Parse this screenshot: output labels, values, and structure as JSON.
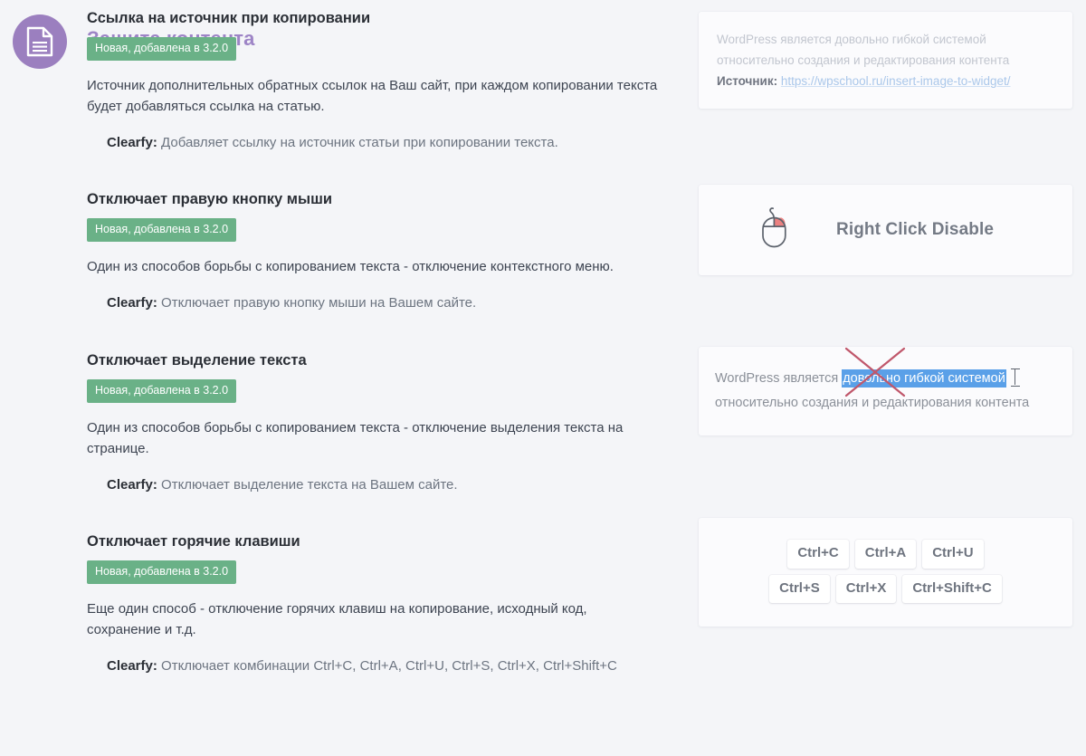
{
  "header": {
    "icon": "document-icon",
    "title": "Защита контента",
    "icon_circle_color": "#9b7fbf",
    "title_color": "#9d84c6"
  },
  "badge_color": "#6ab187",
  "sections": [
    {
      "id": "source-link-on-copy",
      "title": "Ссылка на источник при копировании",
      "badge": "Новая, добавлена в 3.2.0",
      "description": "Источник дополнительных обратных ссылок на Ваш сайт, при каждом копировании текста будет добавляться ссылка на статью.",
      "clearfy_label": "Clearfy:",
      "clearfy_text": "Добавляет ссылку на источник статьи при копировании текста.",
      "preview": {
        "type": "source-link",
        "line1": "WordPress является довольно гибкой системой",
        "line2": "относительно создания и редактирования контента",
        "source_label": "Источник:",
        "source_url": "https://wpschool.ru/insert-image-to-widget/",
        "link_color": "#aac7ea"
      }
    },
    {
      "id": "disable-right-click",
      "title": "Отключает правую кнопку мыши",
      "badge": "Новая, добавлена в 3.2.0",
      "description": "Один из способов борьбы с копированием текста - отключение контекстного меню.",
      "clearfy_label": "Clearfy:",
      "clearfy_text": "Отключает правую кнопку мыши на Вашем сайте.",
      "preview": {
        "type": "right-click-disable",
        "icon": "mouse-icon",
        "label": "Right Click Disable",
        "button_highlight_color": "#ec7f7f"
      }
    },
    {
      "id": "disable-text-selection",
      "title": "Отключает выделение текста",
      "badge": "Новая, добавлена в 3.2.0",
      "description": "Один из способов борьбы с копированием текста - отключение выделения текста на странице.",
      "clearfy_label": "Clearfy:",
      "clearfy_text": "Отключает выделение текста на Вашем сайте.",
      "preview": {
        "type": "text-selection",
        "prefix": "WordPress является ",
        "selected": "довольно гибкой системой",
        "line2": "относительно создания и редактирования контента",
        "selection_color": "#5aa0e8",
        "cross_color": "#c0576b"
      }
    },
    {
      "id": "disable-hotkeys",
      "title": "Отключает горячие клавиши",
      "badge": "Новая, добавлена в 3.2.0",
      "description": "Еще один способ - отключение горячих клавиш на копирование, исходный код, сохранение и т.д.",
      "clearfy_label": "Clearfy:",
      "clearfy_text": "Отключает комбинации Ctrl+C, Ctrl+A, Ctrl+U, Ctrl+S, Ctrl+X, Ctrl+Shift+C",
      "preview": {
        "type": "hotkeys",
        "rows": [
          [
            "Ctrl+C",
            "Ctrl+A",
            "Ctrl+U"
          ],
          [
            "Ctrl+S",
            "Ctrl+X",
            "Ctrl+Shift+C"
          ]
        ]
      }
    }
  ]
}
